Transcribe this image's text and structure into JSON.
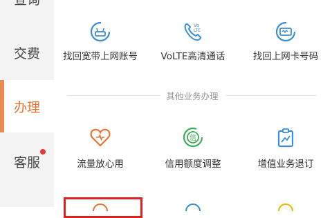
{
  "sidebar": {
    "items": [
      {
        "label": "查询"
      },
      {
        "label": "交费"
      },
      {
        "label": "办理",
        "active": true
      },
      {
        "label": "客服",
        "badge": true
      }
    ],
    "active_color": "#e8732e",
    "badge_color": "#e53935"
  },
  "main": {
    "row1": [
      {
        "label": "找回宽带上网账号",
        "icon": "router-refresh-icon",
        "color": "#3a8dd8"
      },
      {
        "label": "VoLTE高清通话",
        "icon": "phone-volte-icon",
        "color": "#3a8dd8"
      },
      {
        "label": "找回上网卡号码",
        "icon": "sim-card-icon",
        "color": "#3a8dd8"
      }
    ],
    "section_title": "其他业务办理",
    "row2": [
      {
        "label": "流量放心用",
        "icon": "heart-pulse-icon",
        "color": "#e8732e"
      },
      {
        "label": "信用额度调整",
        "icon": "credit-icon",
        "color": "#3fae5a"
      },
      {
        "label": "增值业务退订",
        "icon": "unsubscribe-icon",
        "color": "#3a8dd8"
      }
    ],
    "row3_icons": [
      {
        "icon": "partial-icon",
        "color": "#e8732e"
      },
      {
        "icon": "partial-icon",
        "color": "#3a8dd8"
      },
      {
        "icon": "partial-icon",
        "color": "#f0b400"
      }
    ]
  }
}
